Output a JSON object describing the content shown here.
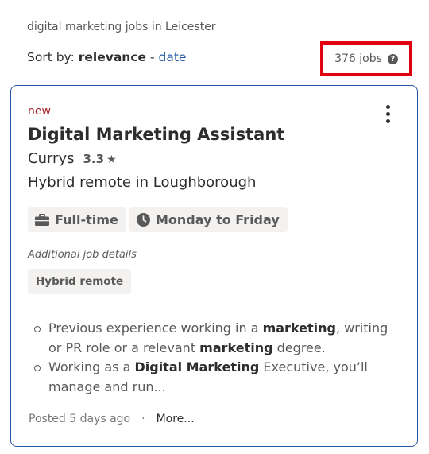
{
  "search": {
    "title": "digital marketing jobs in Leicester"
  },
  "sort": {
    "label": "Sort by:",
    "selected": "relevance",
    "separator": "-",
    "alt": "date"
  },
  "results": {
    "count": "376 jobs",
    "help_icon": "?"
  },
  "job": {
    "badge": "new",
    "title": "Digital Marketing Assistant",
    "company": "Currys",
    "rating": "3.3",
    "rating_star": "★",
    "location": "Hybrid remote in Loughborough",
    "tags": [
      {
        "label": "Full-time",
        "icon": "briefcase-icon"
      },
      {
        "label": "Monday to Friday",
        "icon": "clock-icon"
      }
    ],
    "additional_label": "Additional job details",
    "additional_tags": [
      "Hybrid remote"
    ],
    "snippet": [
      {
        "parts": [
          "Previous experience working in a ",
          "marketing",
          ", writing or PR role or a relevant ",
          "marketing",
          " degree."
        ]
      },
      {
        "parts": [
          "Working as a ",
          "Digital Marketing",
          " Executive, you’ll manage and run..."
        ]
      }
    ],
    "posted": "Posted 5 days ago",
    "separator": "·",
    "more": "More..."
  },
  "colors": {
    "link": "#2557a7",
    "highlight_box": "#e3000f",
    "badge_new": "#a9252b",
    "card_border": "#2557a7"
  }
}
